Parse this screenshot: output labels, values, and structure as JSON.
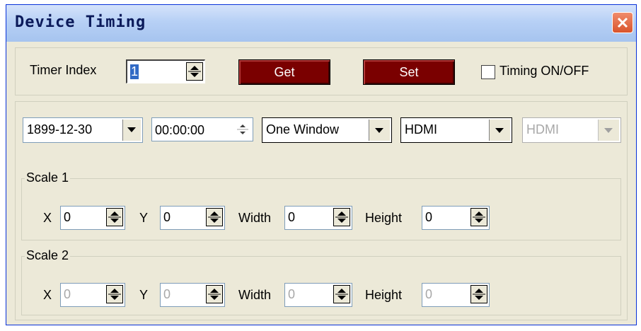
{
  "window": {
    "title": "Device Timing"
  },
  "timer": {
    "index_label": "Timer Index",
    "index_value": "1",
    "get_label": "Get",
    "set_label": "Set",
    "timing_label": "Timing ON/OFF",
    "timing_checked": false
  },
  "controls": {
    "date_value": "1899-12-30",
    "time_value": "00:00:00",
    "window_mode": "One Window",
    "source1": "HDMI",
    "source2": "HDMI"
  },
  "scale1": {
    "title": "Scale 1",
    "x_label": "X",
    "x_value": "0",
    "y_label": "Y",
    "y_value": "0",
    "width_label": "Width",
    "width_value": "0",
    "height_label": "Height",
    "height_value": "0"
  },
  "scale2": {
    "title": "Scale 2",
    "x_label": "X",
    "x_value": "0",
    "y_label": "Y",
    "y_value": "0",
    "width_label": "Width",
    "width_value": "0",
    "height_label": "Height",
    "height_value": "0"
  },
  "colors": {
    "accent_button": "#7a0000",
    "titlebar": "#b7d0f5",
    "close": "#d9542c"
  }
}
